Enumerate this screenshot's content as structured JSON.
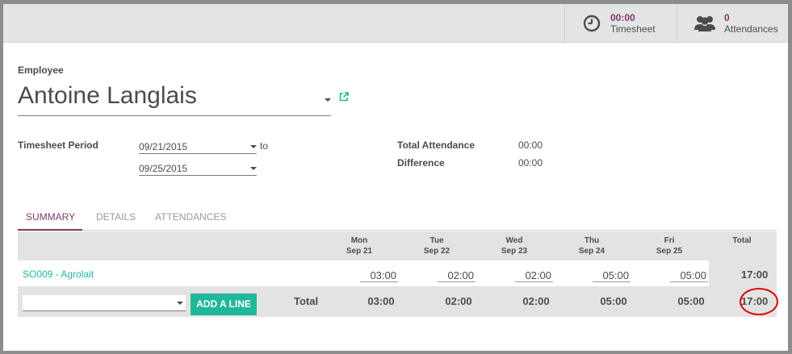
{
  "topbar": {
    "timesheet": {
      "value": "00:00",
      "label": "Timesheet",
      "icon": "clock-icon"
    },
    "attendances": {
      "value": "0",
      "label": "Attendances",
      "icon": "users-icon"
    }
  },
  "employee": {
    "label": "Employee",
    "name": "Antoine Langlais"
  },
  "period": {
    "label": "Timesheet Period",
    "from": "09/21/2015",
    "to_word": "to",
    "to": "09/25/2015"
  },
  "summary_info": {
    "total_attendance_label": "Total Attendance",
    "total_attendance_value": "00:00",
    "difference_label": "Difference",
    "difference_value": "00:00"
  },
  "tabs": [
    {
      "label": "SUMMARY",
      "active": true
    },
    {
      "label": "DETAILS",
      "active": false
    },
    {
      "label": "ATTENDANCES",
      "active": false
    }
  ],
  "table": {
    "columns": [
      {
        "day": "Mon",
        "date": "Sep 21"
      },
      {
        "day": "Tue",
        "date": "Sep 22"
      },
      {
        "day": "Wed",
        "date": "Sep 23"
      },
      {
        "day": "Thu",
        "date": "Sep 24"
      },
      {
        "day": "Fri",
        "date": "Sep 25"
      }
    ],
    "total_header": "Total",
    "rows": [
      {
        "project": "SO009 - Agrolait",
        "values": [
          "03:00",
          "02:00",
          "02:00",
          "05:00",
          "05:00"
        ],
        "total": "17:00"
      }
    ],
    "footer": {
      "add_line_label": "ADD A LINE",
      "total_label": "Total",
      "values": [
        "03:00",
        "02:00",
        "02:00",
        "05:00",
        "05:00"
      ],
      "grand_total": "17:00"
    }
  },
  "colors": {
    "accent": "#7c3a6b",
    "link": "#21b799",
    "highlight": "#e00000"
  }
}
